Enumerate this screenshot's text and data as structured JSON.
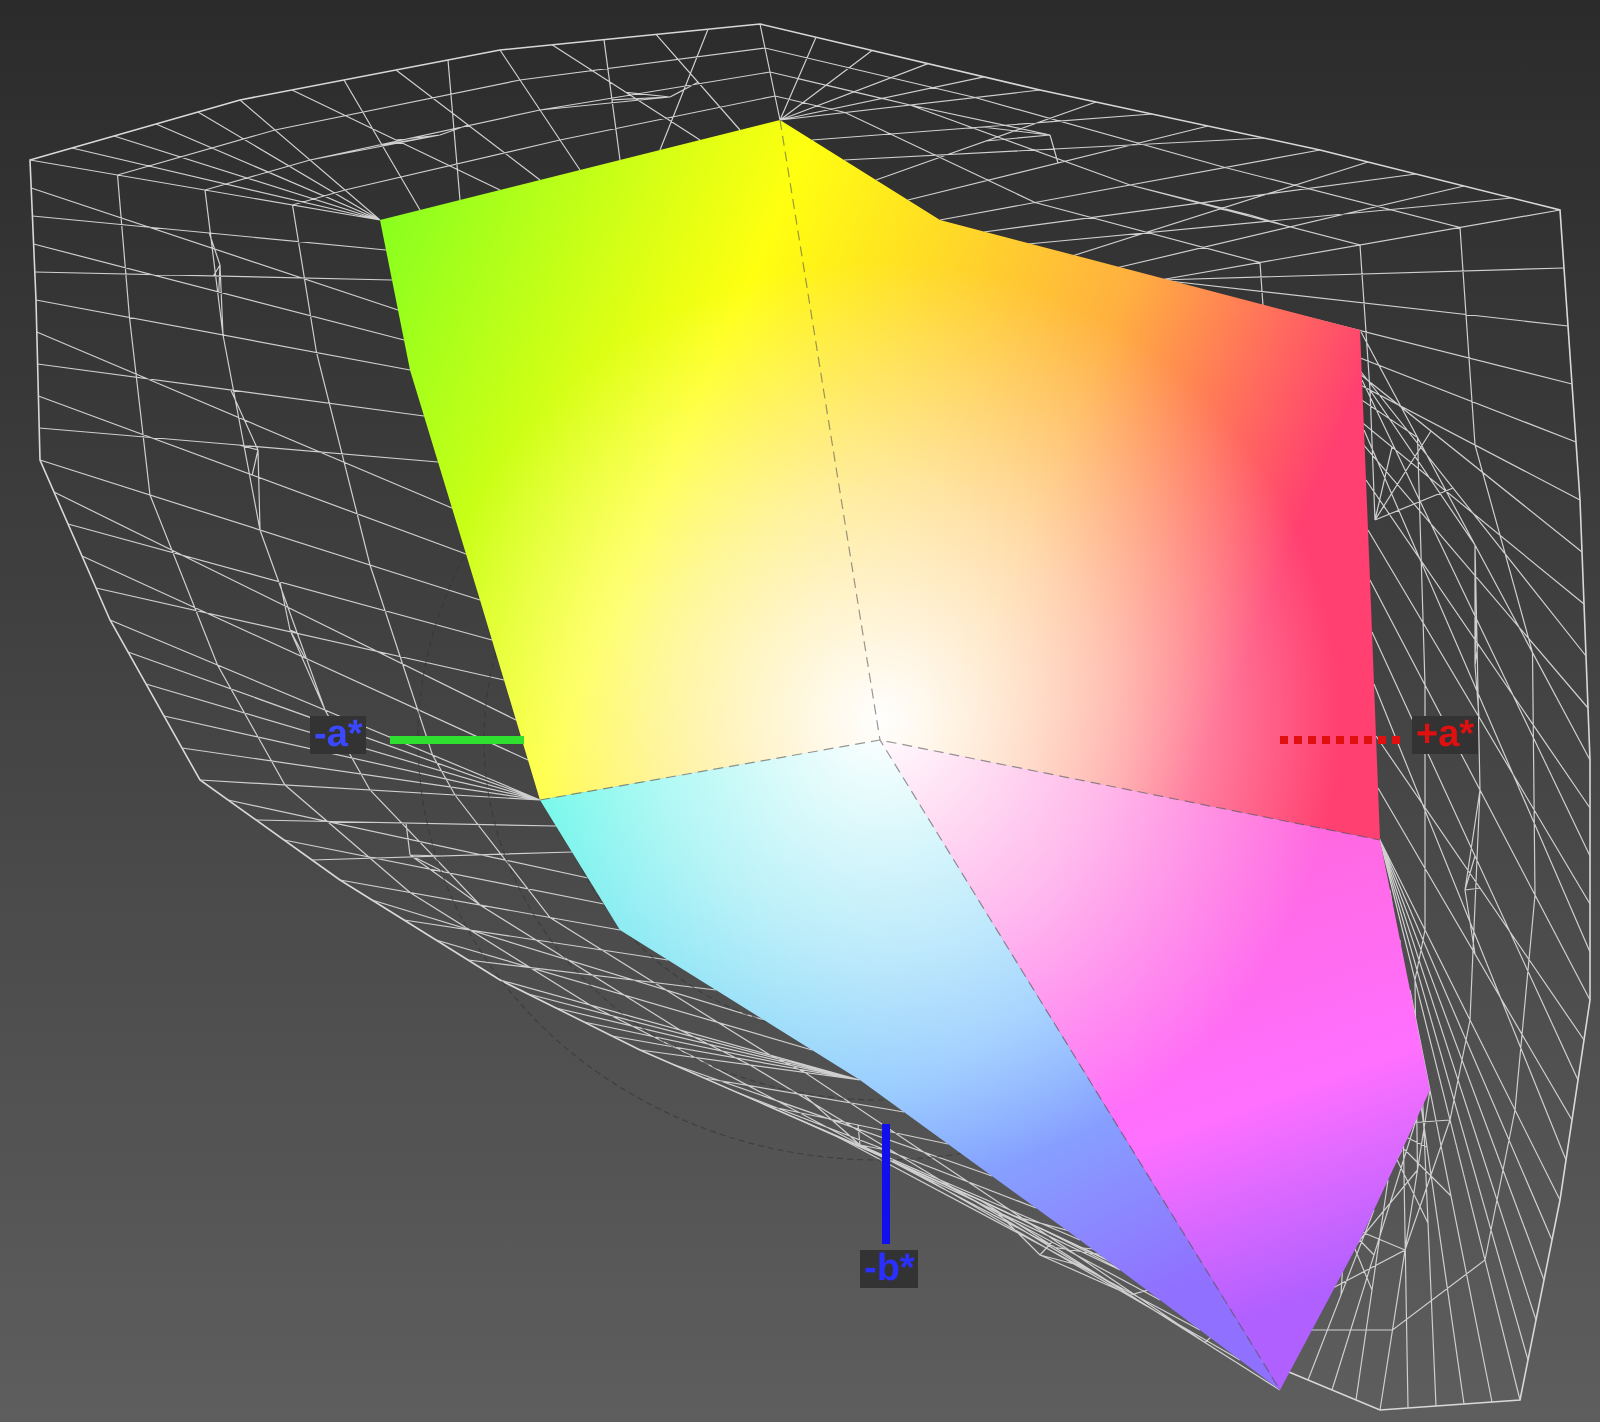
{
  "axis_labels": [
    {
      "text": "-a*",
      "kind": "a_negative"
    },
    {
      "text": "+a*",
      "kind": "a_positive"
    },
    {
      "text": "-b*",
      "kind": "b_negative"
    }
  ]
}
